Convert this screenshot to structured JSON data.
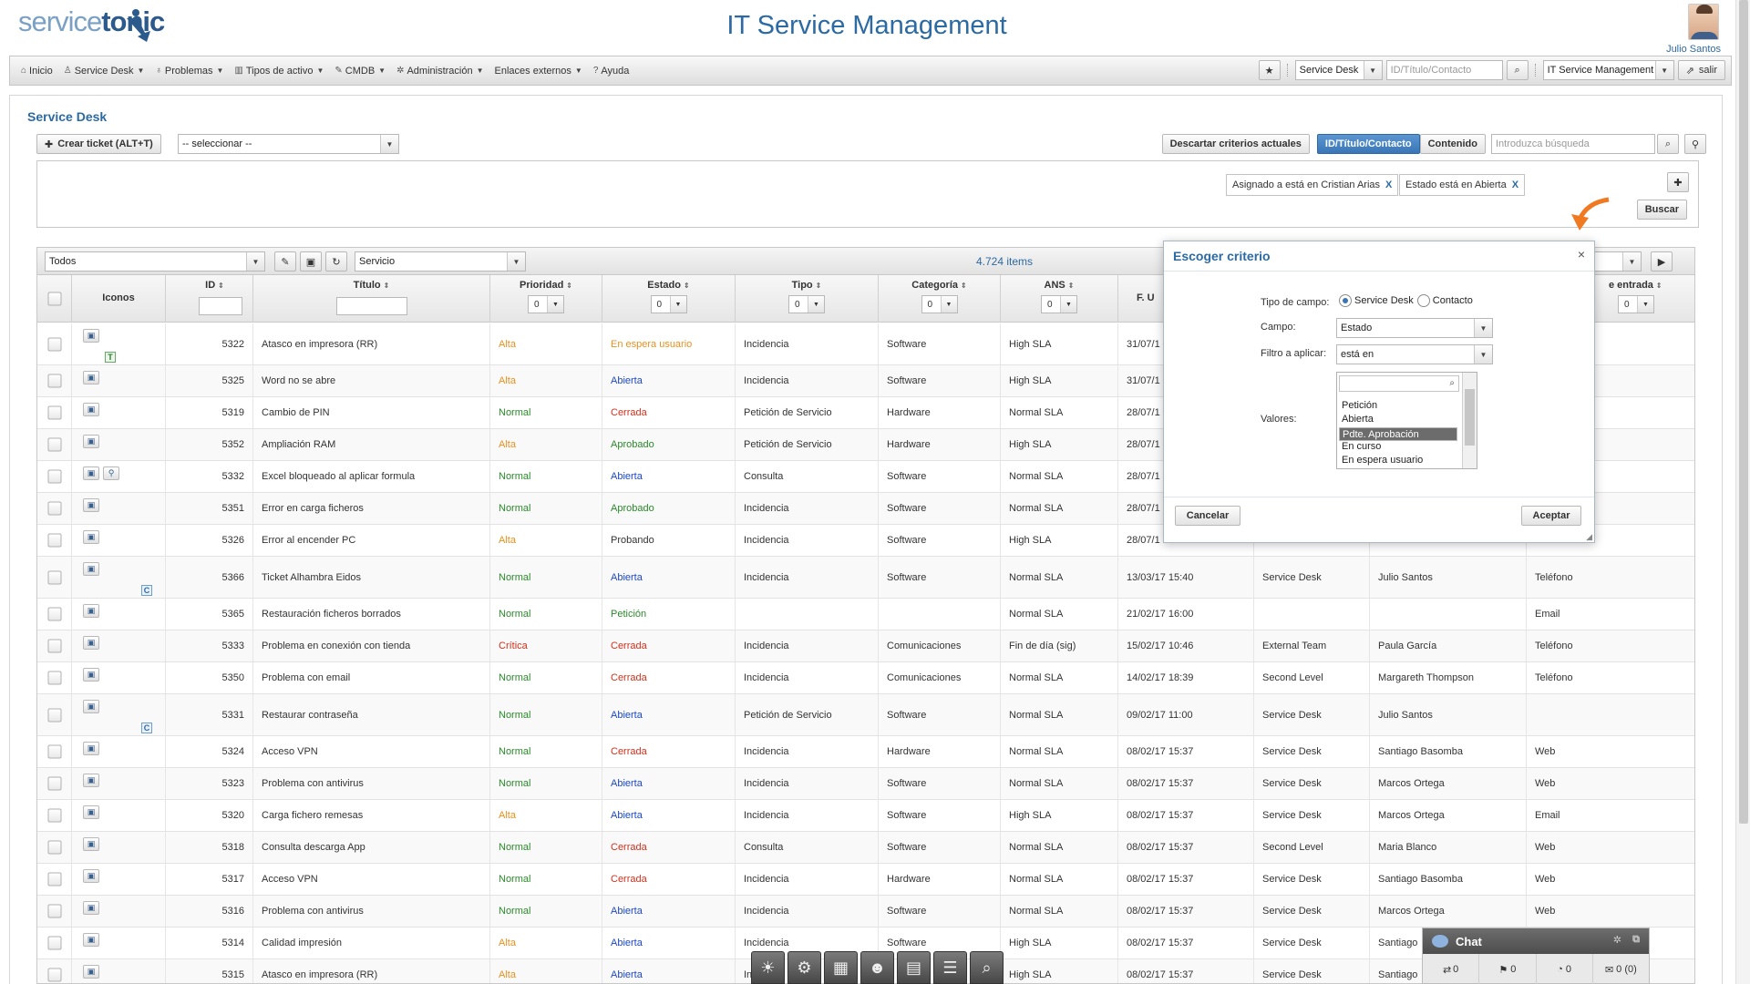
{
  "header": {
    "logo_part1": "service",
    "logo_part2": "tonic",
    "app_title": "IT Service Management",
    "user_name": "Julio Santos"
  },
  "menu": {
    "items": [
      {
        "label": "Inicio",
        "icon": "home-icon"
      },
      {
        "label": "Service Desk",
        "icon": "user-icon"
      },
      {
        "label": "Problemas",
        "icon": "bulb-icon"
      },
      {
        "label": "Tipos de activo",
        "icon": "asset-icon"
      },
      {
        "label": "CMDB",
        "icon": "wrench-icon"
      },
      {
        "label": "Administración",
        "icon": "gear-icon"
      },
      {
        "label": "Enlaces externos",
        "icon": ""
      },
      {
        "label": "Ayuda",
        "icon": "help-icon"
      }
    ],
    "module_select": "Service Desk",
    "search_placeholder": "ID/Título/Contacto",
    "context_select": "IT Service Management",
    "logout_label": "salir"
  },
  "page": {
    "title": "Service Desk",
    "create_label": "Crear ticket (ALT+T)",
    "select_placeholder": "-- seleccionar --",
    "discard_label": "Descartar criterios actuales",
    "tab_id": "ID/Título/Contacto",
    "tab_content": "Contenido",
    "search_placeholder": "Introduzca búsqueda",
    "chips": [
      "Asignado a está en Cristian Arias",
      "Estado está en Abierta"
    ],
    "chip_remove": "X",
    "buscar_label": "Buscar"
  },
  "grid": {
    "view_select": "Todos",
    "group_select": "Servicio",
    "items_count": "4.724 items",
    "filter_zero": "0",
    "columns": {
      "iconos": "Iconos",
      "id": "ID",
      "titulo": "Título",
      "prioridad": "Prioridad",
      "estado": "Estado",
      "tipo": "Tipo",
      "categoria": "Categoría",
      "ans": "ANS",
      "fecha": "F. U",
      "canal": "e entrada"
    },
    "rows": [
      {
        "id": "5322",
        "titulo": "Atasco en impresora (RR)",
        "prioridad": "Alta",
        "estado": "En espera usuario",
        "tipo": "Incidencia",
        "categoria": "Software",
        "ans": "High SLA",
        "fecha": "31/07/1",
        "grupo": "",
        "asignado": "",
        "canal": ""
      },
      {
        "id": "5325",
        "titulo": "Word no se abre",
        "prioridad": "Alta",
        "estado": "Abierta",
        "tipo": "Incidencia",
        "categoria": "Software",
        "ans": "High SLA",
        "fecha": "31/07/1",
        "grupo": "",
        "asignado": "",
        "canal": ""
      },
      {
        "id": "5319",
        "titulo": "Cambio de PIN",
        "prioridad": "Normal",
        "estado": "Cerrada",
        "tipo": "Petición de Servicio",
        "categoria": "Hardware",
        "ans": "Normal SLA",
        "fecha": "28/07/1",
        "grupo": "",
        "asignado": "",
        "canal": ""
      },
      {
        "id": "5352",
        "titulo": "Ampliación RAM",
        "prioridad": "Alta",
        "estado": "Aprobado",
        "tipo": "Petición de Servicio",
        "categoria": "Hardware",
        "ans": "High SLA",
        "fecha": "28/07/1",
        "grupo": "",
        "asignado": "",
        "canal": ""
      },
      {
        "id": "5332",
        "titulo": "Excel bloqueado al aplicar formula",
        "prioridad": "Normal",
        "estado": "Abierta",
        "tipo": "Consulta",
        "categoria": "Software",
        "ans": "Normal SLA",
        "fecha": "28/07/1",
        "grupo": "",
        "asignado": "",
        "canal": ""
      },
      {
        "id": "5351",
        "titulo": "Error en carga ficheros",
        "prioridad": "Normal",
        "estado": "Aprobado",
        "tipo": "Incidencia",
        "categoria": "Software",
        "ans": "Normal SLA",
        "fecha": "28/07/1",
        "grupo": "",
        "asignado": "",
        "canal": ""
      },
      {
        "id": "5326",
        "titulo": "Error al encender PC",
        "prioridad": "Alta",
        "estado": "Probando",
        "tipo": "Incidencia",
        "categoria": "Software",
        "ans": "High SLA",
        "fecha": "28/07/1",
        "grupo": "",
        "asignado": "",
        "canal": ""
      },
      {
        "id": "5366",
        "titulo": "Ticket Alhambra Eidos",
        "prioridad": "Normal",
        "estado": "Abierta",
        "tipo": "Incidencia",
        "categoria": "Software",
        "ans": "Normal SLA",
        "fecha": "13/03/17 15:40",
        "grupo": "Service Desk",
        "asignado": "Julio Santos",
        "canal": "Teléfono"
      },
      {
        "id": "5365",
        "titulo": "Restauración ficheros borrados",
        "prioridad": "Normal",
        "estado": "Petición",
        "tipo": "",
        "categoria": "",
        "ans": "Normal SLA",
        "fecha": "21/02/17 16:00",
        "grupo": "",
        "asignado": "",
        "canal": "Email"
      },
      {
        "id": "5333",
        "titulo": "Problema en conexión con tienda",
        "prioridad": "Crítica",
        "estado": "Cerrada",
        "tipo": "Incidencia",
        "categoria": "Comunicaciones",
        "ans": "Fin de día (sig)",
        "fecha": "15/02/17 10:46",
        "grupo": "External Team",
        "asignado": "Paula García",
        "canal": "Teléfono"
      },
      {
        "id": "5350",
        "titulo": "Problema con email",
        "prioridad": "Normal",
        "estado": "Cerrada",
        "tipo": "Incidencia",
        "categoria": "Comunicaciones",
        "ans": "Normal SLA",
        "fecha": "14/02/17 18:39",
        "grupo": "Second Level",
        "asignado": "Margareth Thompson",
        "canal": "Teléfono"
      },
      {
        "id": "5331",
        "titulo": "Restaurar contraseña",
        "prioridad": "Normal",
        "estado": "Abierta",
        "tipo": "Petición de Servicio",
        "categoria": "Software",
        "ans": "Normal SLA",
        "fecha": "09/02/17 11:00",
        "grupo": "Service Desk",
        "asignado": "Julio Santos",
        "canal": ""
      },
      {
        "id": "5324",
        "titulo": "Acceso VPN",
        "prioridad": "Normal",
        "estado": "Cerrada",
        "tipo": "Incidencia",
        "categoria": "Hardware",
        "ans": "Normal SLA",
        "fecha": "08/02/17 15:37",
        "grupo": "Service Desk",
        "asignado": "Santiago Basomba",
        "canal": "Web"
      },
      {
        "id": "5323",
        "titulo": "Problema con antivirus",
        "prioridad": "Normal",
        "estado": "Abierta",
        "tipo": "Incidencia",
        "categoria": "Software",
        "ans": "Normal SLA",
        "fecha": "08/02/17 15:37",
        "grupo": "Service Desk",
        "asignado": "Marcos Ortega",
        "canal": "Web"
      },
      {
        "id": "5320",
        "titulo": "Carga fichero remesas",
        "prioridad": "Alta",
        "estado": "Abierta",
        "tipo": "Incidencia",
        "categoria": "Software",
        "ans": "High SLA",
        "fecha": "08/02/17 15:37",
        "grupo": "Service Desk",
        "asignado": "Marcos Ortega",
        "canal": "Email"
      },
      {
        "id": "5318",
        "titulo": "Consulta descarga App",
        "prioridad": "Normal",
        "estado": "Cerrada",
        "tipo": "Consulta",
        "categoria": "Software",
        "ans": "Normal SLA",
        "fecha": "08/02/17 15:37",
        "grupo": "Second Level",
        "asignado": "Maria Blanco",
        "canal": "Web"
      },
      {
        "id": "5317",
        "titulo": "Acceso VPN",
        "prioridad": "Normal",
        "estado": "Cerrada",
        "tipo": "Incidencia",
        "categoria": "Hardware",
        "ans": "Normal SLA",
        "fecha": "08/02/17 15:37",
        "grupo": "Service Desk",
        "asignado": "Santiago Basomba",
        "canal": "Web"
      },
      {
        "id": "5316",
        "titulo": "Problema con antivirus",
        "prioridad": "Normal",
        "estado": "Abierta",
        "tipo": "Incidencia",
        "categoria": "Software",
        "ans": "Normal SLA",
        "fecha": "08/02/17 15:37",
        "grupo": "Service Desk",
        "asignado": "Marcos Ortega",
        "canal": "Web"
      },
      {
        "id": "5314",
        "titulo": "Calidad impresión",
        "prioridad": "Alta",
        "estado": "Abierta",
        "tipo": "Incidencia",
        "categoria": "Software",
        "ans": "High SLA",
        "fecha": "08/02/17 15:37",
        "grupo": "Service Desk",
        "asignado": "Santiago",
        "canal": ""
      },
      {
        "id": "5315",
        "titulo": "Atasco en impresora (RR)",
        "prioridad": "Alta",
        "estado": "Abierta",
        "tipo": "In",
        "categoria": "",
        "ans": "High SLA",
        "fecha": "08/02/17 15:37",
        "grupo": "Service Desk",
        "asignado": "Santiago",
        "canal": ""
      }
    ]
  },
  "dialog": {
    "title": "Escoger criterio",
    "close": "×",
    "tipo_label": "Tipo de campo:",
    "radio_sd": "Service Desk",
    "radio_contacto": "Contacto",
    "campo_label": "Campo:",
    "campo_value": "Estado",
    "filtro_label": "Filtro a aplicar:",
    "filtro_value": "está en",
    "valores_label": "Valores:",
    "values": [
      "Petición",
      "Abierta",
      "Pdte. Aprobación",
      "En curso",
      "En espera usuario"
    ],
    "selected_value": "Pdte. Aprobación",
    "cancel_label": "Cancelar",
    "accept_label": "Aceptar"
  },
  "chat": {
    "title": "Chat",
    "stats": [
      "0",
      "0",
      "0",
      "0 (0)"
    ]
  },
  "colors": {
    "accent": "#2c6aa3",
    "alta": "#e8901c",
    "normal": "#2a8a2a",
    "critica": "#d2301c",
    "abierta": "#1c48c8"
  }
}
